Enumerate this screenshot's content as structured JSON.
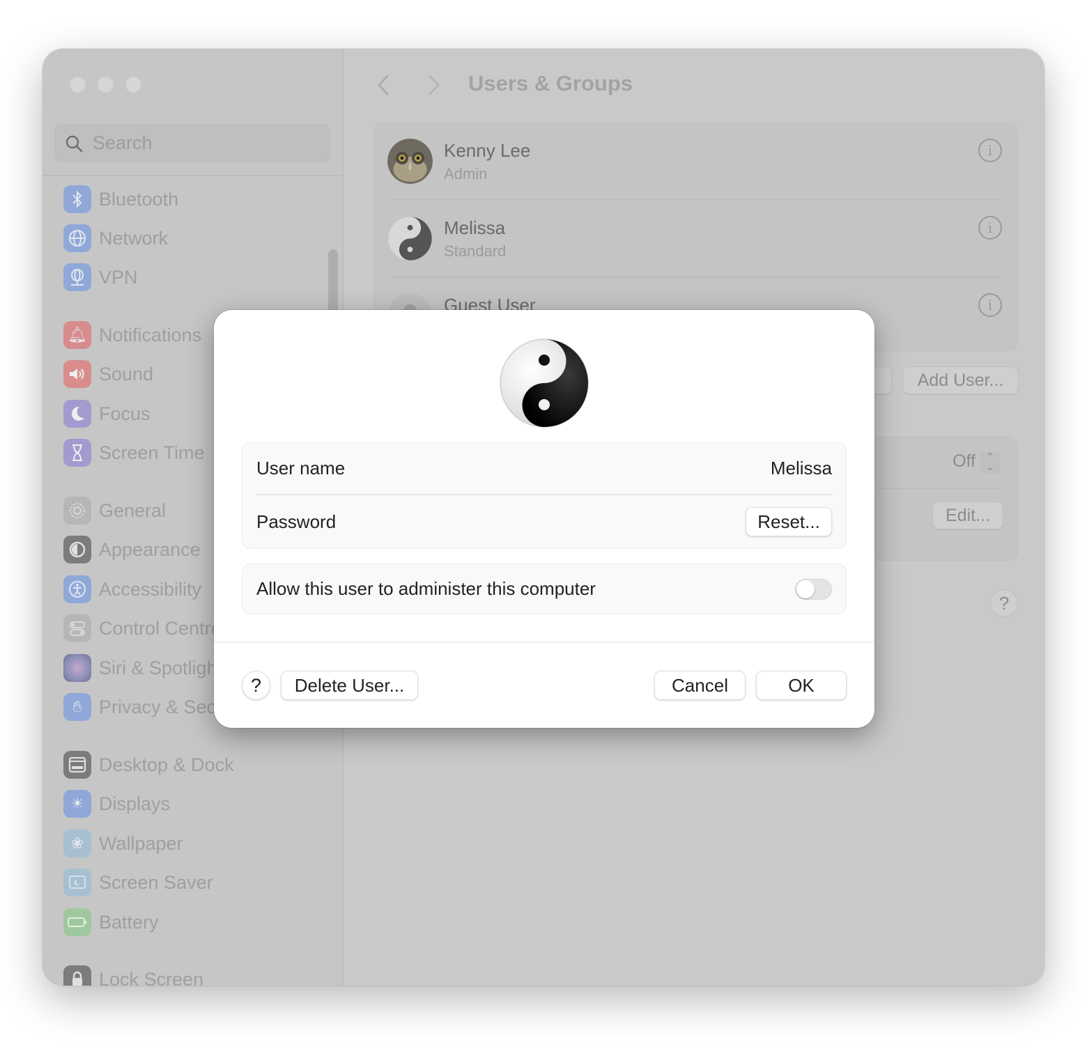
{
  "window": {
    "title": "Users & Groups",
    "traffic_lights": [
      "close",
      "minimize",
      "zoom"
    ]
  },
  "sidebar": {
    "search": {
      "placeholder": "Search",
      "icon": "search-icon"
    },
    "items": [
      {
        "label": "Bluetooth",
        "icon": "bluetooth-icon",
        "color": "#8fa8d8"
      },
      {
        "label": "Network",
        "icon": "globe-icon",
        "color": "#8fa8d8"
      },
      {
        "label": "VPN",
        "icon": "vpn-globe-icon",
        "color": "#8fa8d8"
      },
      {
        "label": "Notifications",
        "icon": "bell-icon",
        "color": "#d88c8c"
      },
      {
        "label": "Sound",
        "icon": "speaker-icon",
        "color": "#d88c8c"
      },
      {
        "label": "Focus",
        "icon": "moon-icon",
        "color": "#a49ad0"
      },
      {
        "label": "Screen Time",
        "icon": "hourglass-icon",
        "color": "#a49ad0"
      },
      {
        "label": "General",
        "icon": "gear-icon",
        "color": "#b6b6b6"
      },
      {
        "label": "Appearance",
        "icon": "appearance-icon",
        "color": "#7c7c7c"
      },
      {
        "label": "Accessibility",
        "icon": "accessibility-icon",
        "color": "#8fa8d8"
      },
      {
        "label": "Control Centre",
        "icon": "toggles-icon",
        "color": "#b6b6b6"
      },
      {
        "label": "Siri & Spotlight",
        "icon": "siri-icon",
        "color": "#a48fb6"
      },
      {
        "label": "Privacy & Security",
        "icon": "hand-icon",
        "color": "#8fa8d8"
      },
      {
        "label": "Desktop & Dock",
        "icon": "dock-icon",
        "color": "#7c7c7c"
      },
      {
        "label": "Displays",
        "icon": "sun-icon",
        "color": "#8fa8d8"
      },
      {
        "label": "Wallpaper",
        "icon": "flower-icon",
        "color": "#a6c0d2"
      },
      {
        "label": "Screen Saver",
        "icon": "screensaver-icon",
        "color": "#a6c0d2"
      },
      {
        "label": "Battery",
        "icon": "battery-icon",
        "color": "#9fc89f"
      },
      {
        "label": "Lock Screen",
        "icon": "lock-icon",
        "color": "#7c7c7c"
      }
    ]
  },
  "main": {
    "back_icon": "chevron-left-icon",
    "forward_icon": "chevron-right-icon",
    "title": "Users & Groups",
    "users": [
      {
        "name": "Kenny Lee",
        "role": "Admin",
        "avatar": "owl-avatar"
      },
      {
        "name": "Melissa",
        "role": "Standard",
        "avatar": "yin-yang-avatar"
      },
      {
        "name": "Guest User",
        "role": "",
        "avatar": "guest-avatar"
      }
    ],
    "add_group_label_partial": "...",
    "add_user_label": "Add User...",
    "setting_value": "Off",
    "edit_label": "Edit...",
    "help_label": "?"
  },
  "dialog": {
    "avatar": "yin-yang-avatar",
    "user_name_label": "User name",
    "user_name_value": "Melissa",
    "password_label": "Password",
    "reset_label": "Reset...",
    "admin_label": "Allow this user to administer this computer",
    "admin_enabled": false,
    "help_label": "?",
    "delete_label": "Delete User...",
    "cancel_label": "Cancel",
    "ok_label": "OK"
  }
}
